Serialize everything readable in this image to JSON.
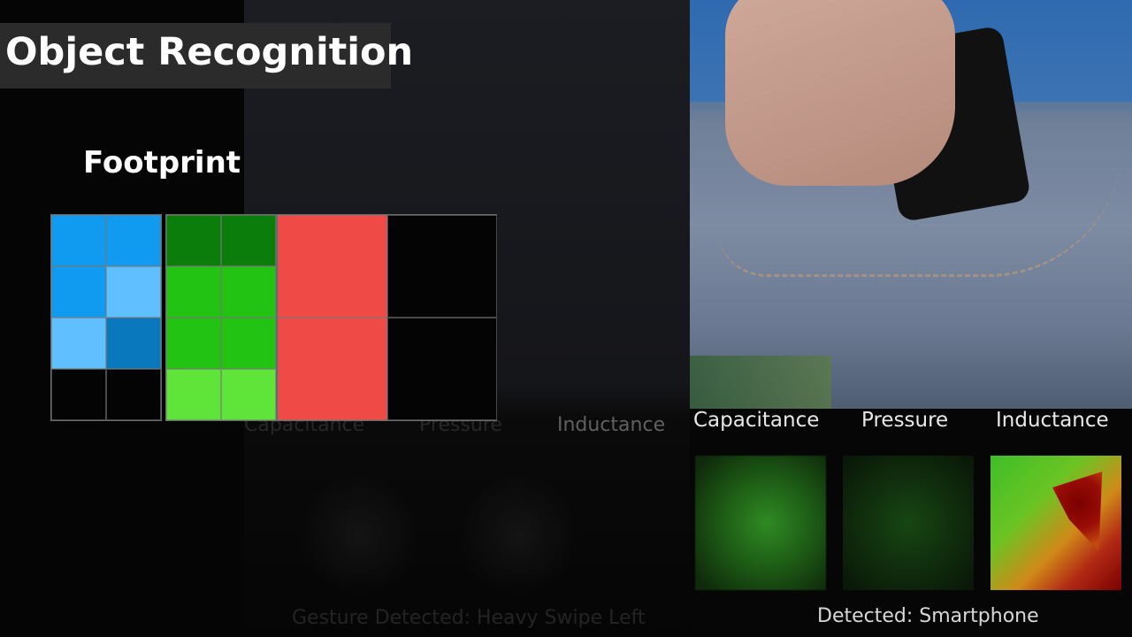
{
  "title": "Object Recognition",
  "footprint_label": "Footprint",
  "colors": {
    "blue_light": "#60c0ff",
    "blue": "#119bf0",
    "blue_dark": "#0a78bc",
    "green_dark": "#0b7d0b",
    "green": "#22c312",
    "green_light": "#5fe43a",
    "red": "#f04a47",
    "black": "#040404"
  },
  "middle_panel": {
    "labels": [
      "Capacitance",
      "Pressure",
      "Inductance"
    ],
    "gesture": "Gesture Detected: Heavy Swipe Left"
  },
  "right_panel": {
    "labels": [
      "Capacitance",
      "Pressure",
      "Inductance"
    ],
    "detected": "Detected: Smartphone"
  }
}
